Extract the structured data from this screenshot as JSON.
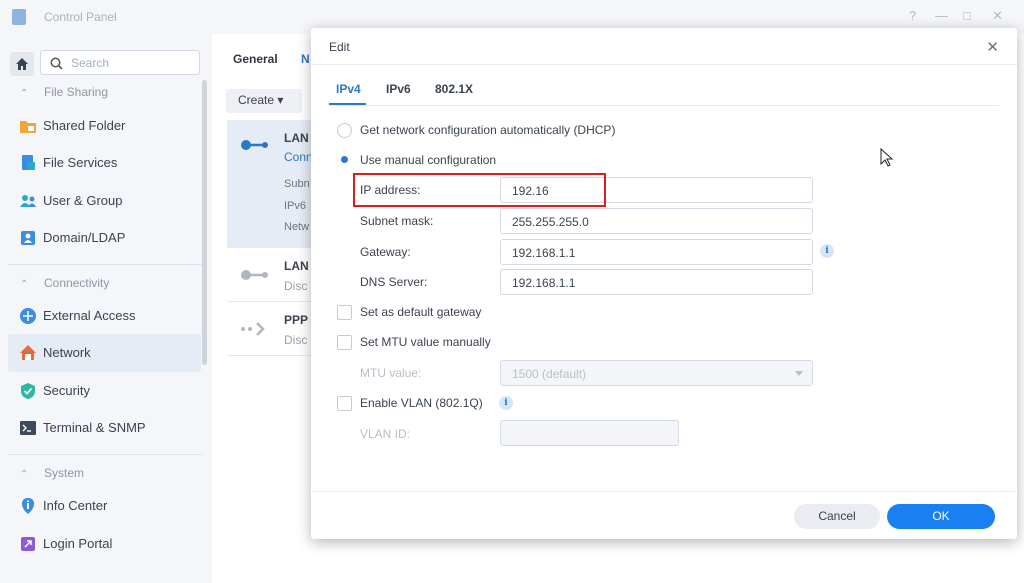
{
  "window": {
    "title": "Control Panel",
    "controls": [
      "?",
      "—",
      "□",
      "✕"
    ]
  },
  "sidebar": {
    "search_placeholder": "Search",
    "sections": [
      {
        "title": "File Sharing",
        "items": [
          "Shared Folder",
          "File Services",
          "User & Group",
          "Domain/LDAP"
        ]
      },
      {
        "title": "Connectivity",
        "items": [
          "External Access",
          "Network",
          "Security",
          "Terminal & SNMP"
        ]
      },
      {
        "title": "System",
        "items": [
          "Info Center",
          "Login Portal"
        ]
      }
    ],
    "active_item": "Network"
  },
  "background": {
    "tabs": [
      "General",
      "N"
    ],
    "create_label": "Create ▾",
    "interfaces": [
      {
        "name": "LAN",
        "status": "Conn",
        "details": [
          "Subn",
          "IPv6",
          "Netw"
        ]
      },
      {
        "name": "LAN",
        "status": "Disc"
      },
      {
        "name": "PPP",
        "status": "Disc"
      }
    ]
  },
  "dialog": {
    "title": "Edit",
    "close": "✕",
    "tabs": [
      "IPv4",
      "IPv6",
      "802.1X"
    ],
    "active_tab": "IPv4",
    "options": {
      "dhcp": "Get network configuration automatically (DHCP)",
      "manual": "Use manual configuration"
    },
    "fields": {
      "ip_label": "IP address:",
      "ip_value": "192.16",
      "subnet_label": "Subnet mask:",
      "subnet_value": "255.255.255.0",
      "gateway_label": "Gateway:",
      "gateway_value": "192.168.1.1",
      "dns_label": "DNS Server:",
      "dns_value": "192.168.1.1"
    },
    "checkboxes": {
      "default_gateway": "Set as default gateway",
      "mtu_manual": "Set MTU value manually",
      "vlan": "Enable VLAN (802.1Q)"
    },
    "mtu_label": "MTU value:",
    "mtu_value": "1500 (default)",
    "vlan_label": "VLAN ID:",
    "info_glyph": "i",
    "buttons": {
      "cancel": "Cancel",
      "ok": "OK"
    }
  },
  "colors": {
    "accent": "#2a78c8",
    "ok_button": "#1a7ff0",
    "highlight": "#d81e1e"
  }
}
